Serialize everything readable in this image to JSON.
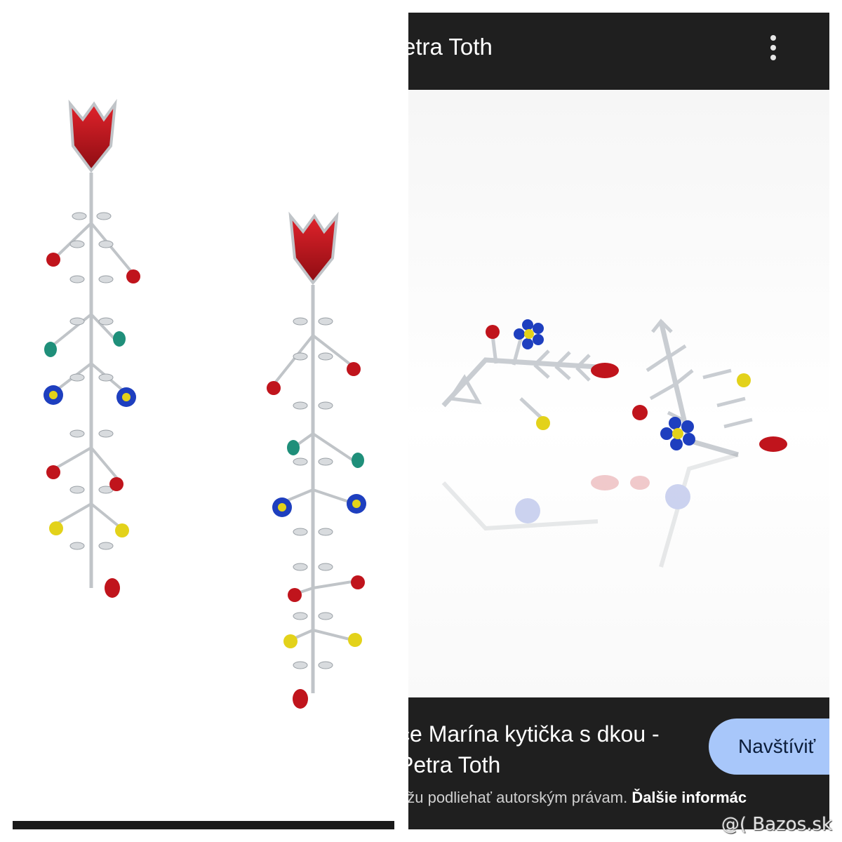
{
  "topbar": {
    "title": "etra Toth",
    "menu_icon": "more-vert-icon"
  },
  "result": {
    "title": "ce Marína kytička s dkou - Petra Toth",
    "visit_label": "Navštíviť",
    "disclaimer_text": "ôžu podliehať autorským právam. ",
    "disclaimer_link": "Ďalšie informác"
  },
  "watermark": "@( Bazos.sk",
  "colors": {
    "dark_bar": "#1f1f1f",
    "button_bg": "#a8c7fa",
    "silver": "#c9cdd2",
    "red_stone": "#c0141c",
    "blue_stone": "#1e3fbf",
    "yellow_stone": "#e3d21a",
    "teal_stone": "#1f8f7a"
  }
}
